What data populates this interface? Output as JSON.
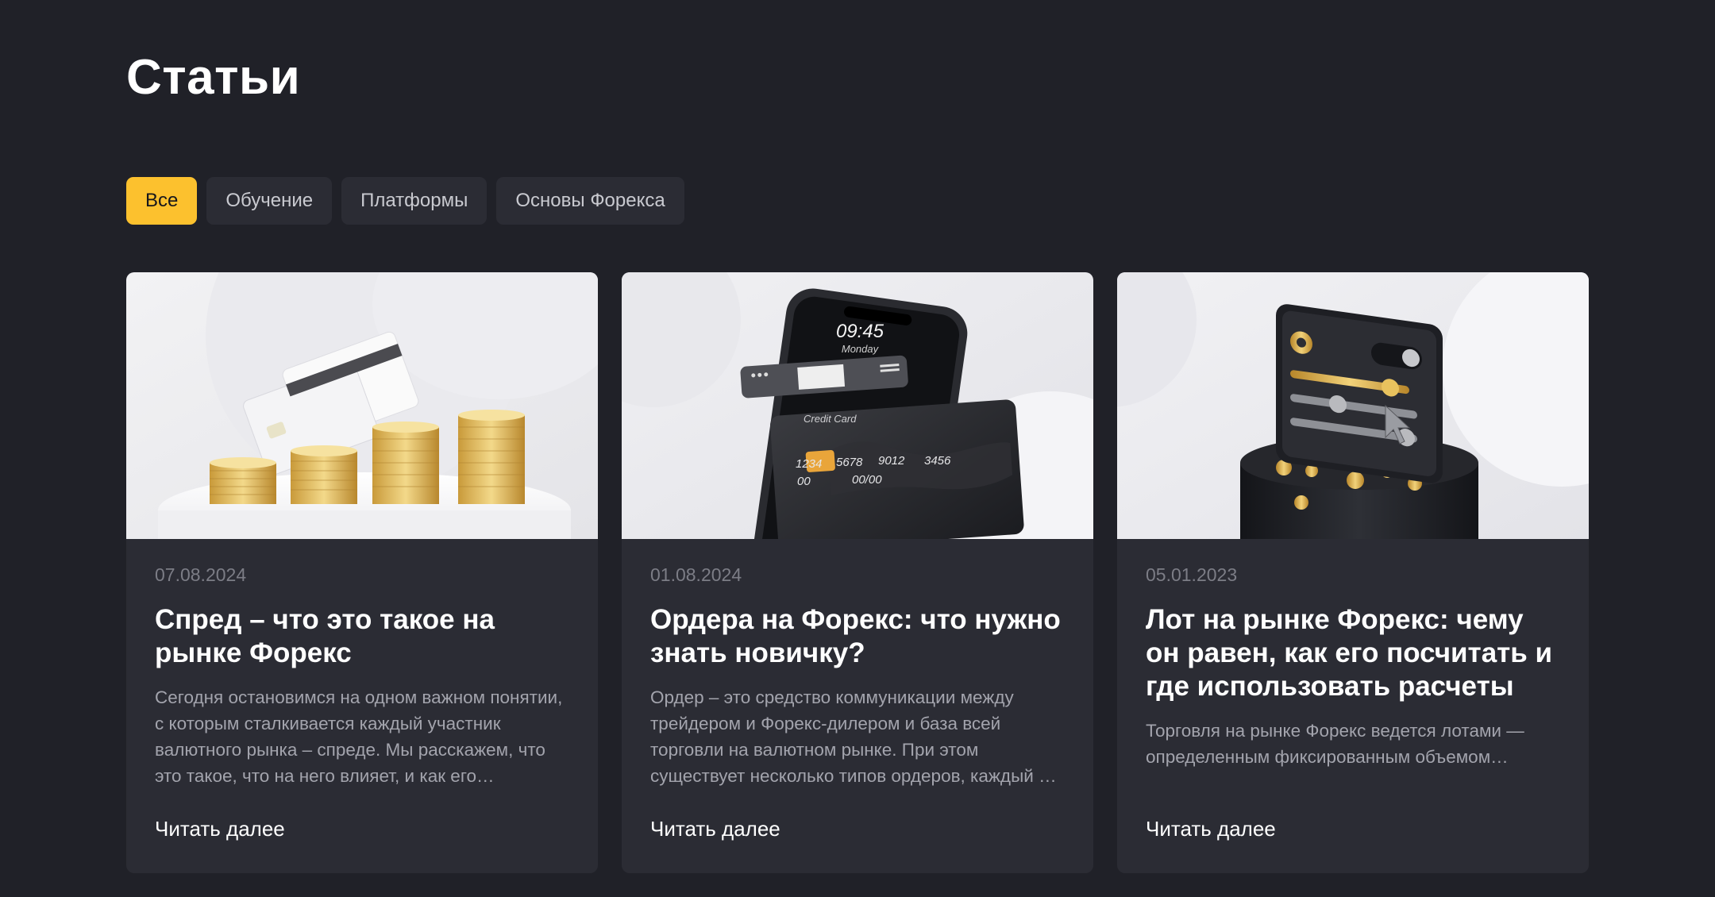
{
  "page": {
    "title": "Статьи"
  },
  "filters": [
    {
      "label": "Все",
      "active": true
    },
    {
      "label": "Обучение",
      "active": false
    },
    {
      "label": "Платформы",
      "active": false
    },
    {
      "label": "Основы Форекса",
      "active": false
    }
  ],
  "colors": {
    "background": "#202128",
    "card": "#2b2c34",
    "accent": "#fcc12e"
  },
  "articles": [
    {
      "date": "07.08.2024",
      "title": "Спред – что это такое на рынке Форекс",
      "excerpt": "Сегодня остановимся на одном важном понятии, с которым сталкивается каждый участник валютного рынка – спреде. Мы расскажем, что это такое, что на него влияет, и как его рассчитать.",
      "read_more": "Читать далее",
      "image": "coins-and-cards-illustration"
    },
    {
      "date": "01.08.2024",
      "title": "Ордера на Форекс: что нужно знать новичку?",
      "excerpt": "Ордер – это средство коммуникации между трейдером и Форекс-дилером и база всей торговли на валютном рынке. При этом существует несколько типов ордеров, каждый из которых имеет свои особенности.",
      "read_more": "Читать далее",
      "image": "phone-and-credit-card-illustration",
      "image_text": {
        "time": "09:45",
        "day": "Monday",
        "card_label": "Credit Card",
        "card_number": [
          "1234",
          "5678",
          "9012",
          "3456"
        ],
        "card_sub": [
          "00",
          "00/00"
        ]
      }
    },
    {
      "date": "05.01.2023",
      "title": "Лот на рынке Форекс: чему он равен, как его посчитать и где использовать расчеты",
      "excerpt": "Торговля на рынке Форекс ведется лотами — определенным фиксированным объемом валюты.",
      "read_more": "Читать далее",
      "image": "settings-sliders-illustration"
    }
  ]
}
